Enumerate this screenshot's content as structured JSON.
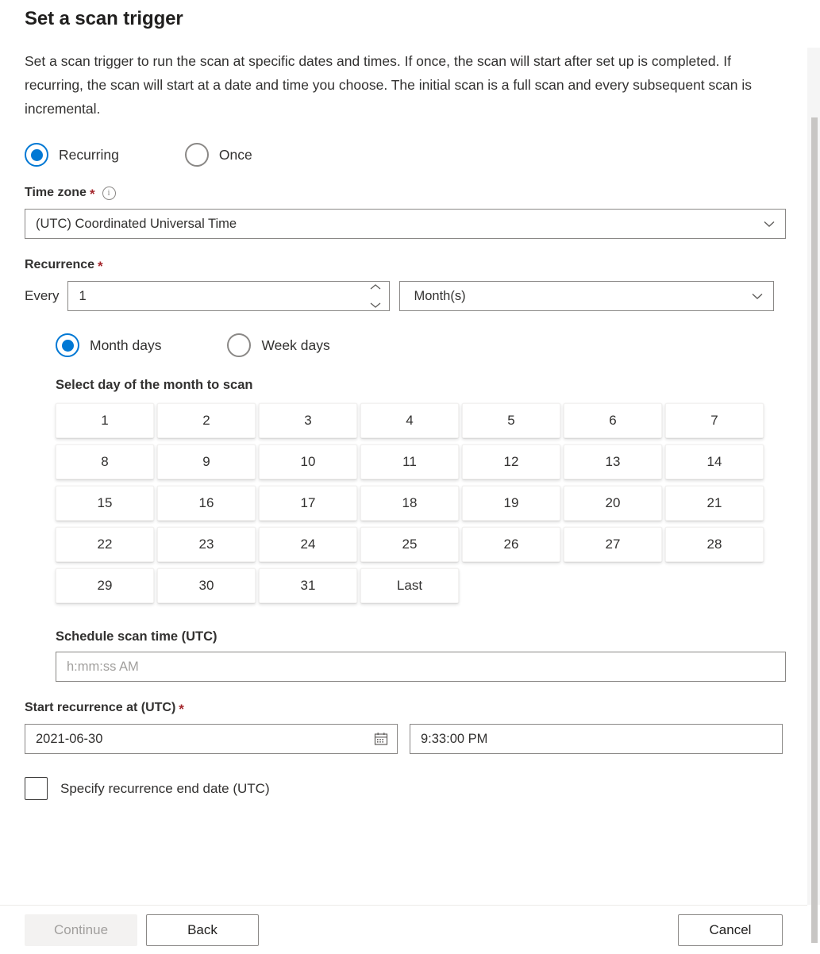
{
  "dialog": {
    "title": "Set a scan trigger",
    "description": "Set a scan trigger to run the scan at specific dates and times. If once, the scan will start after set up is completed. If recurring, the scan will start at a date and time you choose. The initial scan is a full scan and every subsequent scan is incremental."
  },
  "trigger_mode": {
    "options": [
      {
        "label": "Recurring",
        "selected": true
      },
      {
        "label": "Once",
        "selected": false
      }
    ]
  },
  "time_zone": {
    "label": "Time zone",
    "required_marker": "*",
    "info_icon": "info-icon",
    "value": "(UTC) Coordinated Universal Time",
    "chevron_icon": "chevron-down-icon"
  },
  "recurrence": {
    "label": "Recurrence",
    "required_marker": "*",
    "every_label": "Every",
    "interval_value": "1",
    "spinner_up_icon": "chevron-up-icon",
    "spinner_down_icon": "chevron-down-icon",
    "unit_value": "Month(s)",
    "unit_chevron_icon": "chevron-down-icon",
    "mode_options": [
      {
        "label": "Month days",
        "selected": true
      },
      {
        "label": "Week days",
        "selected": false
      }
    ],
    "day_picker_label": "Select day of the month to scan",
    "days": [
      "1",
      "2",
      "3",
      "4",
      "5",
      "6",
      "7",
      "8",
      "9",
      "10",
      "11",
      "12",
      "13",
      "14",
      "15",
      "16",
      "17",
      "18",
      "19",
      "20",
      "21",
      "22",
      "23",
      "24",
      "25",
      "26",
      "27",
      "28",
      "29",
      "30",
      "31",
      "Last"
    ]
  },
  "schedule_scan_time": {
    "label": "Schedule scan time (UTC)",
    "placeholder": "h:mm:ss AM",
    "value": ""
  },
  "start_recurrence": {
    "label": "Start recurrence at (UTC)",
    "required_marker": "*",
    "date_value": "2021-06-30",
    "calendar_icon": "calendar-icon",
    "time_value": "9:33:00 PM"
  },
  "end_date_checkbox": {
    "label": "Specify recurrence end date (UTC)",
    "checked": false
  },
  "footer": {
    "continue_label": "Continue",
    "back_label": "Back",
    "cancel_label": "Cancel"
  },
  "colors": {
    "accent": "#0078d4",
    "required": "#a4262c",
    "border": "#8a8886",
    "text": "#323130",
    "disabled_text": "#a19f9d"
  }
}
